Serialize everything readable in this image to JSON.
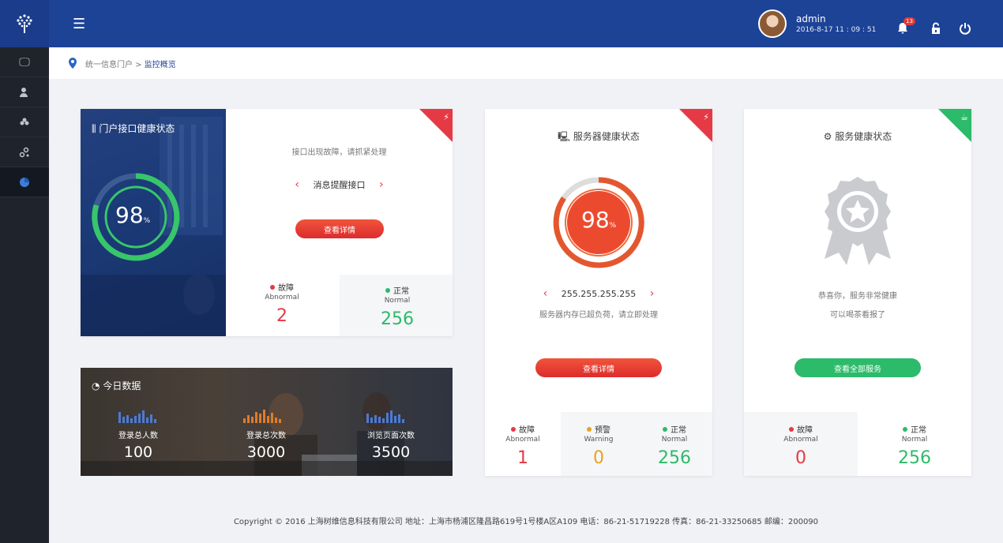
{
  "user": {
    "name": "admin",
    "datetime": "2016-8-17  11 : 09 : 51",
    "notification_count": "13"
  },
  "breadcrumb": {
    "root": "统一信息门户 >",
    "current": "监控概览"
  },
  "portal": {
    "title": "门户接口健康状态",
    "percent": "98",
    "unit": "%",
    "message": "接口出现故障，请抓紧处理",
    "interface_name": "消息提醒接口",
    "button": "查看详情",
    "abnormal": {
      "label": "故障",
      "en": "Abnormal",
      "value": "2"
    },
    "normal": {
      "label": "正常",
      "en": "Normal",
      "value": "256"
    }
  },
  "server": {
    "title": "服务器健康状态",
    "percent": "98",
    "unit": "%",
    "ip": "255.255.255.255",
    "message": "服务器内存已超负荷，请立即处理",
    "button": "查看详情",
    "abnormal": {
      "label": "故障",
      "en": "Abnormal",
      "value": "1"
    },
    "warning": {
      "label": "预警",
      "en": "Warning",
      "value": "0"
    },
    "normal": {
      "label": "正常",
      "en": "Normal",
      "value": "256"
    }
  },
  "service": {
    "title": "服务健康状态",
    "message1": "恭喜你，服务非常健康",
    "message2": "可以喝茶看报了",
    "button": "查看全部服务",
    "abnormal": {
      "label": "故障",
      "en": "Abnormal",
      "value": "0"
    },
    "normal": {
      "label": "正常",
      "en": "Normal",
      "value": "256"
    }
  },
  "today": {
    "title": "今日数据",
    "stats": [
      {
        "label": "登录总人数",
        "value": "100",
        "color": "#4c7ad6"
      },
      {
        "label": "登录总次数",
        "value": "3000",
        "color": "#e07b2a"
      },
      {
        "label": "浏览页面次数",
        "value": "3500",
        "color": "#4c7ad6"
      }
    ]
  },
  "colors": {
    "red": "#e53945",
    "green": "#2bbb6a",
    "orange": "#e8a21e",
    "brand": "#1d4397"
  },
  "footer": "Copyright  ©  2016 上海树维信息科技有限公司    地址：上海市杨浦区隆昌路619号1号楼A区A109    电话：86-21-51719228    传真：86-21-33250685    邮编：200090"
}
